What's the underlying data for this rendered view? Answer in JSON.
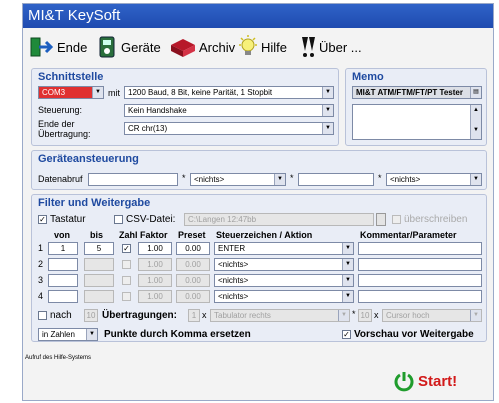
{
  "window": {
    "title": "MI&T KeySoft"
  },
  "toolbar": {
    "ende": "Ende",
    "geraete": "Geräte",
    "archiv": "Archiv",
    "hilfe": "Hilfe",
    "ueber": "Über ..."
  },
  "schnittstelle": {
    "title": "Schnittstelle",
    "port": "COM3",
    "mit": "mit",
    "settings": "1200 Baud, 8 Bit,  keine Parität, 1 Stopbit",
    "steuerung_label": "Steuerung:",
    "steuerung": "Kein Handshake",
    "ende_label": "Ende der Übertragung:",
    "ende": "CR    chr(13)"
  },
  "memo": {
    "title": "Memo",
    "value": "MI&T ATM/FTM/FT/PT Tester"
  },
  "geraeteansteuerung": {
    "title": "Geräteansteuerung",
    "datenabruf_label": "Datenabruf",
    "f1": "",
    "sel1": "<nichts>",
    "f2": "",
    "sel2": "<nichts>"
  },
  "filter": {
    "title": "Filter und Weitergabe",
    "tastatur": "Tastatur",
    "csv": "CSV-Datei:",
    "csv_path": "C:\\Langen 12:47bb",
    "ueberschreiben": "überschreiben",
    "headers": {
      "von": "von",
      "bis": "bis",
      "zahl": "Zahl",
      "faktor": "Faktor",
      "preset": "Preset",
      "steuer": "Steuerzeichen / Aktion",
      "kommentar": "Kommentar/Parameter"
    },
    "rows": [
      {
        "n": "1",
        "von": "1",
        "bis": "5",
        "faktor": "1.00",
        "preset": "0.00",
        "aktion": "ENTER",
        "kommentar": ""
      },
      {
        "n": "2",
        "von": "",
        "bis": "",
        "faktor": "1.00",
        "preset": "0.00",
        "aktion": "<nichts>",
        "kommentar": ""
      },
      {
        "n": "3",
        "von": "",
        "bis": "",
        "faktor": "1.00",
        "preset": "0.00",
        "aktion": "<nichts>",
        "kommentar": ""
      },
      {
        "n": "4",
        "von": "",
        "bis": "",
        "faktor": "1.00",
        "preset": "0.00",
        "aktion": "<nichts>",
        "kommentar": ""
      }
    ],
    "nach": "nach",
    "nach_val": "10",
    "uebertragungen": "Übertragungen:",
    "ue_val": "1",
    "x": "x",
    "tab_sel": "Tabulator rechts",
    "x2": "x",
    "x2_val": "10",
    "cursor_sel": "Cursor hoch",
    "zahlen": "in Zahlen",
    "punkte": "Punkte durch Komma ersetzen",
    "vorschau": "Vorschau vor Weitergabe"
  },
  "status": "Aufruf des Hilfe-Systems",
  "start": "Start!"
}
